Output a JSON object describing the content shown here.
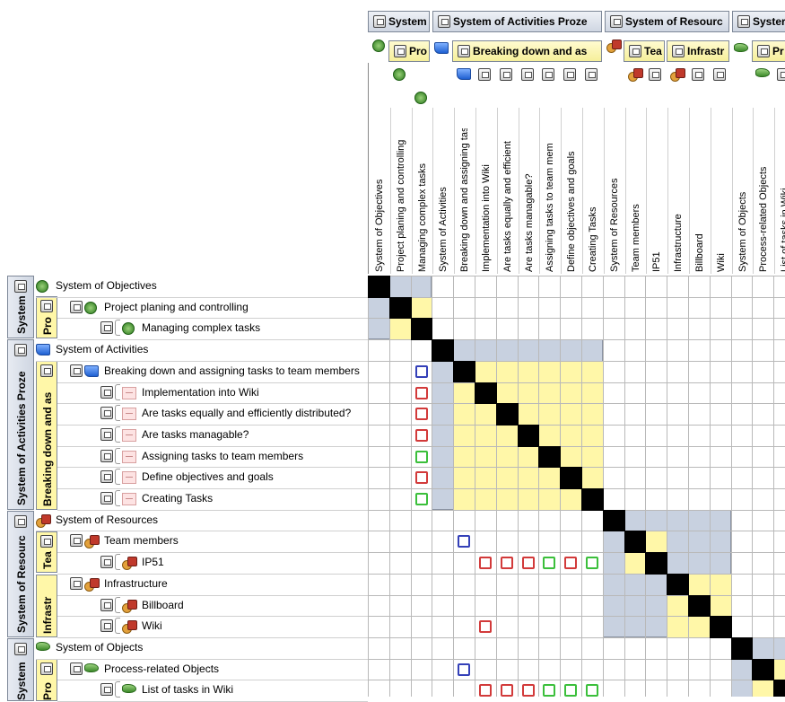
{
  "column_groups": [
    {
      "label": "System of Activities Proze"
    },
    {
      "label": "System of Resourc"
    },
    {
      "label": "Breaking down and as"
    },
    {
      "label": "Infrastr"
    }
  ],
  "column_group_clipped": {
    "system_of_objectives": "System",
    "pro": "Pro",
    "team": "Tea",
    "objects_sys": "Syster",
    "objects_pro": "Pr"
  },
  "columns": [
    "System of Objectives",
    "Project planing and controlling",
    "Managing complex tasks",
    "System of Activities",
    "Breaking down and assigning tasks",
    "Implementation into Wiki",
    "Are tasks equally and efficient",
    "Are tasks managable?",
    "Assigning tasks to team mem",
    "Define objectives and goals",
    "Creating Tasks",
    "System of Resources",
    "Team members",
    "IP51",
    "Infrastructure",
    "Billboard",
    "Wiki",
    "System of Objects",
    "Process-related Objects",
    "List of tasks in Wiki"
  ],
  "rows": [
    "System of Objectives",
    "Project planing and controlling",
    "Managing complex tasks",
    "System of Activities",
    "Breaking down and assigning tasks to team members",
    "Implementation into Wiki",
    "Are tasks equally and efficiently distributed?",
    "Are tasks managable?",
    "Assigning tasks to team members",
    "Define objectives and goals",
    "Creating Tasks",
    "System of Resources",
    "Team members",
    "IP51",
    "Infrastructure",
    "Billboard",
    "Wiki",
    "System of Objects",
    "Process-related Objects",
    "List of tasks in Wiki"
  ],
  "row_groups": {
    "objectives_sys": "System",
    "objectives_pro": "Pro",
    "activities_sys": "System of Activities Proze",
    "activities_sub": "Breaking down and as",
    "resources_sys": "System of Resourc",
    "resources_team": "Tea",
    "resources_infra": "Infrastr",
    "objects_sys": "System",
    "objects_pro": "Pro"
  },
  "marks": [
    {
      "row": 4,
      "col": 2,
      "color": "blue"
    },
    {
      "row": 5,
      "col": 2,
      "color": "red"
    },
    {
      "row": 6,
      "col": 2,
      "color": "red"
    },
    {
      "row": 7,
      "col": 2,
      "color": "red"
    },
    {
      "row": 8,
      "col": 2,
      "color": "green"
    },
    {
      "row": 9,
      "col": 2,
      "color": "red"
    },
    {
      "row": 10,
      "col": 2,
      "color": "green"
    },
    {
      "row": 12,
      "col": 4,
      "color": "blue"
    },
    {
      "row": 13,
      "col": 5,
      "color": "red"
    },
    {
      "row": 13,
      "col": 6,
      "color": "red"
    },
    {
      "row": 13,
      "col": 7,
      "color": "red"
    },
    {
      "row": 13,
      "col": 8,
      "color": "green"
    },
    {
      "row": 13,
      "col": 9,
      "color": "red"
    },
    {
      "row": 13,
      "col": 10,
      "color": "green"
    },
    {
      "row": 16,
      "col": 5,
      "color": "red"
    },
    {
      "row": 18,
      "col": 4,
      "color": "blue"
    },
    {
      "row": 19,
      "col": 5,
      "color": "red"
    },
    {
      "row": 19,
      "col": 6,
      "color": "red"
    },
    {
      "row": 19,
      "col": 7,
      "color": "red"
    },
    {
      "row": 19,
      "col": 8,
      "color": "green"
    },
    {
      "row": 19,
      "col": 9,
      "color": "green"
    },
    {
      "row": 19,
      "col": 10,
      "color": "green"
    }
  ],
  "colors": {
    "diagonal": "#000000",
    "block": "#c8d1e0",
    "sub_block": "#fff7a8",
    "grid": "#b9b9b9"
  }
}
